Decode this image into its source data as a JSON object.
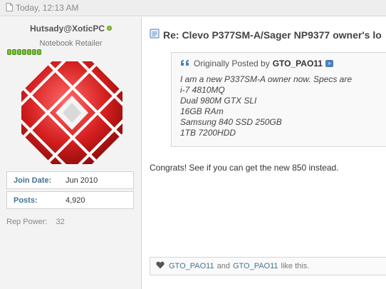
{
  "post": {
    "date": "Today, 12:13 AM"
  },
  "user": {
    "name": "Hutsady@XoticPC",
    "title": "Notebook Retailer",
    "join_label": "Join Date:",
    "join_value": "Jun 2010",
    "posts_label": "Posts:",
    "posts_value": "4,920",
    "rep_power_label": "Rep Power:",
    "rep_power_value": "32"
  },
  "content": {
    "title": "Re: Clevo P377SM-A/Sager NP9377 owner's lo",
    "quote": {
      "prefix": "Originally Posted by",
      "author": "GTO_PAO11",
      "lines": [
        "I am a new P337SM-A owner now. Specs are",
        "i-7 4810MQ",
        "Dual 980M GTX SLI",
        "16GB RAm",
        "Samsung 840 SSD 250GB",
        "1TB 7200HDD"
      ]
    },
    "message": "Congrats! See if you can get the new 850 instead."
  },
  "likes": {
    "user1": "GTO_PAO11",
    "joiner": "and",
    "user2": "GTO_PAO11",
    "suffix": "like this."
  },
  "colors": {
    "link": "#417394",
    "avatar_red": "#d41e1e",
    "online": "#8cc63e"
  },
  "icons": [
    "document-icon",
    "online-status-icon",
    "avatar-gem-logo",
    "quote-icon",
    "view-post-icon",
    "heart-icon"
  ]
}
